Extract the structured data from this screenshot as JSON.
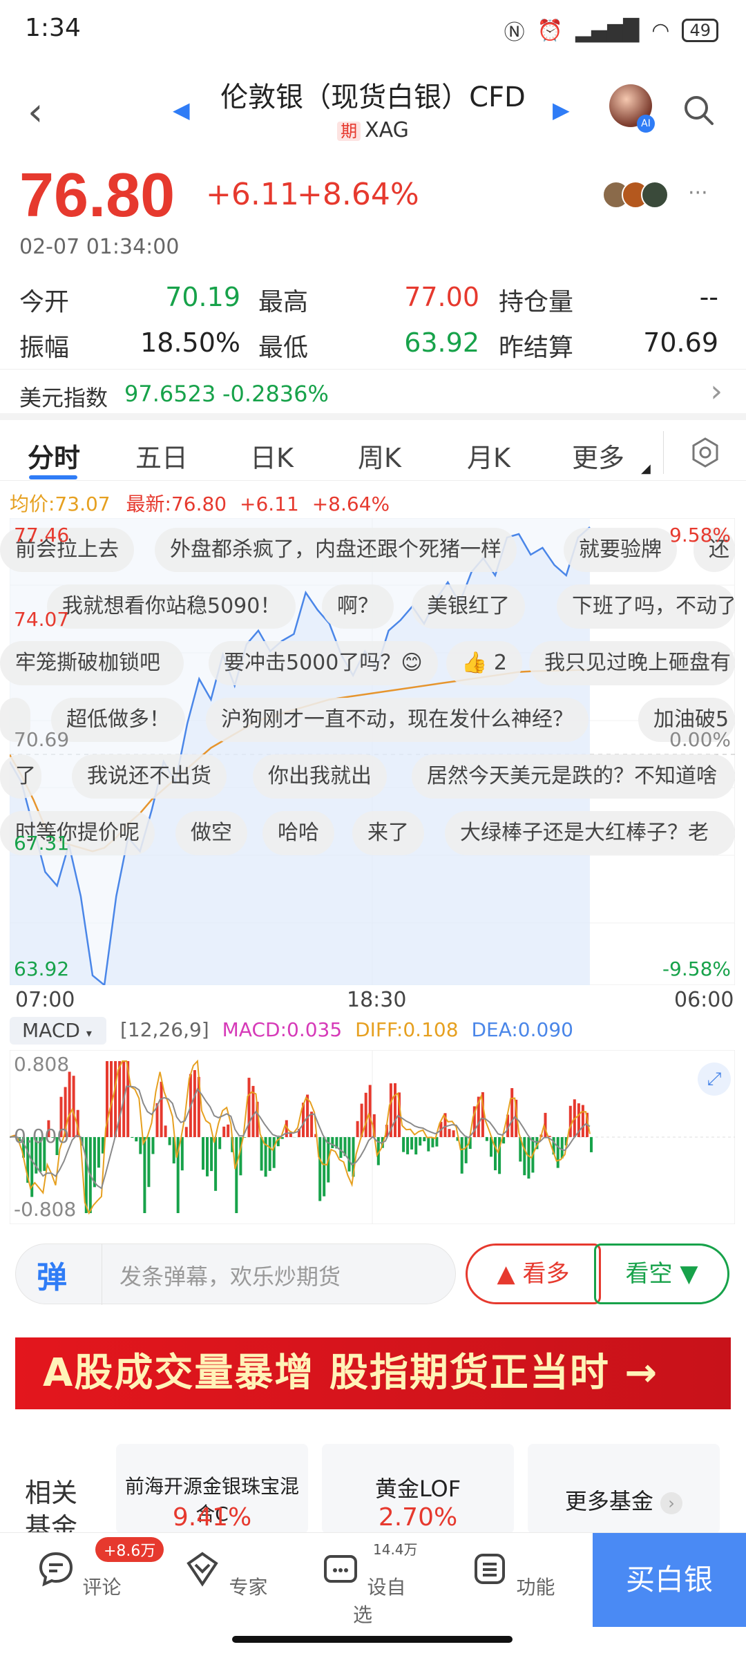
{
  "status": {
    "time": "1:34",
    "battery": "49",
    "icons": [
      "nfc-icon",
      "alarm-icon",
      "signal-icon",
      "wifi-icon"
    ]
  },
  "header": {
    "title": "伦敦银（现货白银）CFD",
    "badge": "期",
    "symbol": "XAG"
  },
  "quote": {
    "price": "76.80",
    "change": "+6.11",
    "change_pct": "+8.64%",
    "datetime": "02-07 01:34:00",
    "stats": [
      {
        "label": "今开",
        "value": "70.19",
        "color": "green"
      },
      {
        "label": "最高",
        "value": "77.00",
        "color": "red"
      },
      {
        "label": "持仓量",
        "value": "--",
        "color": "dark"
      },
      {
        "label": "振幅",
        "value": "18.50%",
        "color": "dark"
      },
      {
        "label": "最低",
        "value": "63.92",
        "color": "green"
      },
      {
        "label": "昨结算",
        "value": "70.69",
        "color": "dark"
      }
    ],
    "dxy": {
      "label": "美元指数",
      "value": "97.6523",
      "change": "-0.2836%"
    }
  },
  "tabs": [
    "分时",
    "五日",
    "日K",
    "周K",
    "月K",
    "更多"
  ],
  "quote_line": {
    "avg": "均价:73.07",
    "latest": "最新:76.80",
    "change": "+6.11",
    "pct": "+8.64%"
  },
  "chart": {
    "y_top": "77.46",
    "y_mid_hi": "74.07",
    "y_mid": "70.69",
    "y_mid_lo": "67.31",
    "y_bottom": "63.92",
    "pct_top": "9.58%",
    "pct_mid": "0.00%",
    "pct_bottom": "-9.58%",
    "x_labels": [
      "07:00",
      "18:30",
      "06:00"
    ]
  },
  "chart_data": {
    "type": "line",
    "x_range": [
      "07:00",
      "06:00"
    ],
    "ylim": [
      63.92,
      77.46
    ],
    "baseline": 70.69,
    "series": [
      {
        "name": "",
        "values": [
          70.4,
          69.8,
          68.5,
          67.2,
          66.8,
          68.0,
          66.5,
          64.2,
          63.92,
          66.5,
          68.2,
          67.8,
          69.0,
          70.4,
          69.8,
          71.5,
          72.8,
          72.2,
          73.5,
          72.6,
          73.8,
          74.2,
          73.6,
          73.9,
          74.1,
          75.3,
          74.8,
          74.4,
          73.5,
          72.9,
          73.6,
          73.1,
          74.2,
          74.5,
          74.9,
          74.4,
          75.1,
          75.6,
          75.0,
          75.9,
          76.3,
          75.8,
          76.9,
          77.0,
          76.4,
          76.6,
          76.1,
          75.8,
          76.9,
          77.2
        ]
      },
      {
        "name": "",
        "values": [
          70.6,
          70.0,
          69.3,
          68.5,
          68.1,
          68.0,
          67.9,
          67.8,
          67.9,
          68.2,
          68.6,
          68.9,
          69.3,
          69.6,
          69.9,
          70.2,
          70.5,
          70.8,
          71.0,
          71.2,
          71.4,
          71.6,
          71.7,
          71.8,
          71.9,
          72.0,
          72.1,
          72.2,
          72.25,
          72.3,
          72.35,
          72.4,
          72.45,
          72.5,
          72.55,
          72.6,
          72.65,
          72.7,
          72.75,
          72.8,
          72.85,
          72.9,
          72.95,
          73.0,
          73.02,
          73.03,
          73.04,
          73.05,
          73.06,
          73.07
        ]
      }
    ]
  },
  "danmaku": [
    "前会拉上去",
    "外盘都杀疯了，内盘还跟个死猪一样",
    "就要验牌",
    "还",
    "我就想看你站稳5090！",
    "啊？",
    "美银红了",
    "下班了吗，不动了",
    "牢笼撕破枷锁吧",
    "要冲击5000了吗？😊",
    "2",
    "我只见过晚上砸盘有",
    "",
    "超低做多！",
    "沪狗刚才一直不动，现在发什么神经？",
    "加油破5",
    "了",
    "我说还不出货",
    "你出我就出",
    "居然今天美元是跌的？不知道啥",
    "时等你提价呢",
    "做空",
    "哈哈",
    "来了",
    "大绿棒子还是大红棒子？老"
  ],
  "macd": {
    "selector": "MACD",
    "params": "[12,26,9]",
    "macd": "MACD:0.035",
    "diff": "DIFF:0.108",
    "dea": "DEA:0.090",
    "y_top": "0.808",
    "y_mid": "0.000",
    "y_bottom": "-0.808"
  },
  "input": {
    "placeholder": "发条弹幕，欢乐炒期货",
    "dan_icon": "弹",
    "bull": "看多",
    "bear": "看空"
  },
  "banner": "A股成交量暴增 股指期货正当时 →",
  "related": {
    "label": "相关基金",
    "funds": [
      {
        "name": "前海开源金银珠宝混合C",
        "value": "9.41%"
      },
      {
        "name": "黄金LOF",
        "value": "2.70%"
      },
      {
        "name": "更多基金",
        "value": ""
      }
    ]
  },
  "nav": {
    "items": [
      {
        "label": "评论",
        "badge": "+8.6万"
      },
      {
        "label": "专家",
        "badge": ""
      },
      {
        "label": "设自选",
        "badge": "14.4万"
      },
      {
        "label": "功能",
        "badge": ""
      }
    ],
    "buy": "买白银"
  }
}
